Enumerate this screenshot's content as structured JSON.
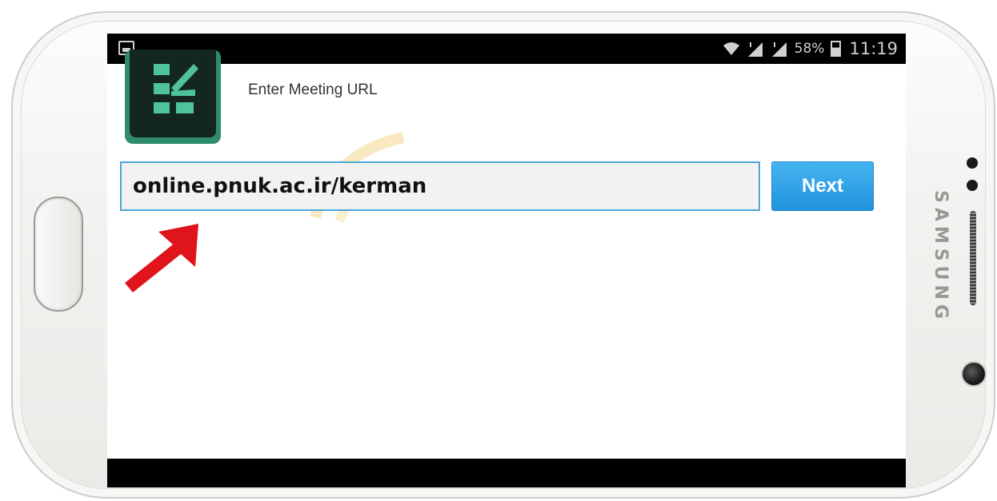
{
  "device": {
    "brand": "SAMSUNG"
  },
  "status_bar": {
    "battery_percent": "58%",
    "time": "11:19",
    "icons": [
      "image-icon",
      "wifi-icon",
      "signal-icon",
      "signal-icon",
      "battery-icon"
    ]
  },
  "app": {
    "logo_icon": "adobe-connect-logo",
    "title": "Enter Meeting URL",
    "url_input": {
      "value": "online.pnuk.ac.ir/kerman"
    },
    "next_label": "Next"
  },
  "annotation": {
    "icon": "red-arrow-icon",
    "color": "#e0141b"
  },
  "colors": {
    "input_border": "#4aa7d8",
    "button": "#1f93dc",
    "logo_green": "#2f8c6a",
    "logo_dark": "#142620"
  }
}
